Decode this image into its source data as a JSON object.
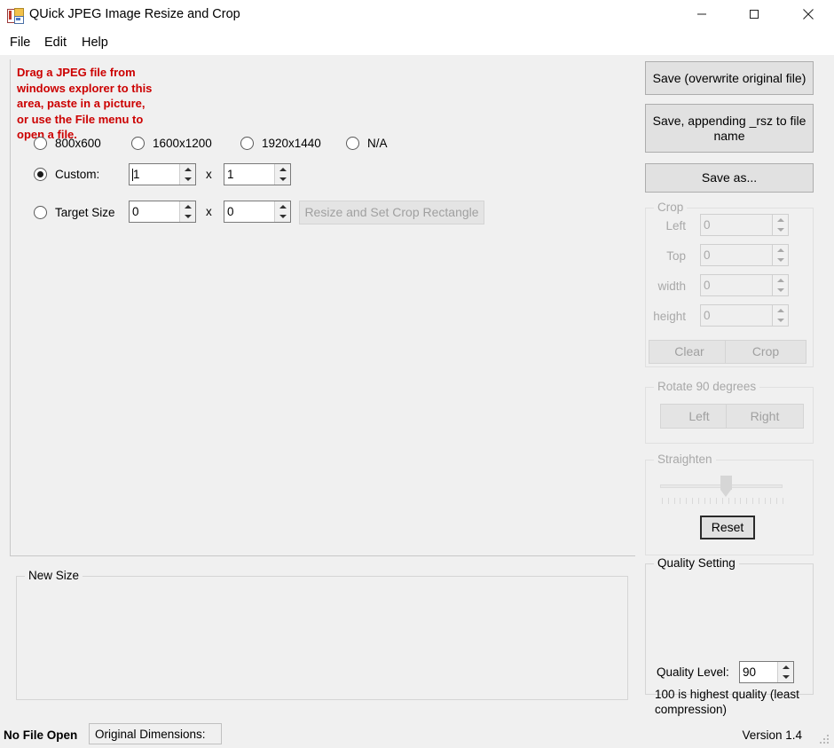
{
  "window": {
    "title": "QUick JPEG Image Resize and Crop",
    "icon": "app-icon",
    "controls": {
      "minimize": "minimize-icon",
      "maximize": "maximize-icon",
      "close": "close-icon"
    }
  },
  "menu": {
    "items": [
      {
        "label": "File"
      },
      {
        "label": "Edit"
      },
      {
        "label": "Help"
      }
    ]
  },
  "picture_area": {
    "hint_text": "Drag a JPEG file from\nwindows explorer to this\narea, paste in a picture,\nor use the File menu to\nopen a file.",
    "hint_color": "#cc0000"
  },
  "save_buttons": {
    "overwrite": "Save (overwrite original file)",
    "append": "Save, appending _rsz to file name",
    "save_as": "Save as..."
  },
  "crop": {
    "title": "Crop",
    "fields": [
      {
        "label": "Left",
        "value": "0"
      },
      {
        "label": "Top",
        "value": "0"
      },
      {
        "label": "width",
        "value": "0"
      },
      {
        "label": "height",
        "value": "0"
      }
    ],
    "clear_label": "Clear",
    "crop_label": "Crop"
  },
  "rotate": {
    "title": "Rotate 90 degrees",
    "left_label": "Left",
    "right_label": "Right"
  },
  "straighten": {
    "title": "Straighten",
    "reset_label": "Reset",
    "slider_value": 50,
    "tick_count": 21
  },
  "new_size": {
    "title": "New Size",
    "presets": [
      {
        "label": "800x600",
        "checked": false
      },
      {
        "label": "1600x1200",
        "checked": false
      },
      {
        "label": "1920x1440",
        "checked": false
      },
      {
        "label": "N/A",
        "checked": false
      }
    ],
    "custom": {
      "label": "Custom:",
      "checked": true,
      "width": "1",
      "height": "1",
      "separator": "x"
    },
    "target": {
      "label": "Target Size",
      "checked": false,
      "width": "0",
      "height": "0",
      "separator": "x"
    },
    "resize_crop_label": "Resize and Set Crop Rectangle"
  },
  "quality": {
    "title": "Quality Setting",
    "level_label": "Quality Level:",
    "level_value": "90",
    "note": "100 is highest quality (least compression)"
  },
  "status": {
    "file_state": "No File Open",
    "dimensions_label": "Original Dimensions:",
    "version": "Version 1.4"
  }
}
